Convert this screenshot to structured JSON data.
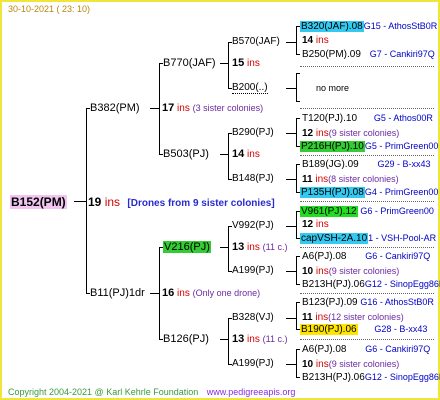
{
  "header": {
    "date": "30-10-2021 ( 23: 10)"
  },
  "root": {
    "name": "B152(PM)",
    "ins": "19",
    "ins_label": "ins",
    "note": "[Drones from 9 sister colonies]"
  },
  "gen2": [
    {
      "name": "B382(PM)",
      "ins": "17",
      "ins_label": "ins",
      "note": "(3 sister colonies)"
    },
    {
      "name": "B11(PJ)1dr",
      "ins": "16",
      "ins_label": "ins",
      "note": "(Only one drone)"
    }
  ],
  "gen3": [
    {
      "name": "B770(JAF)",
      "ins": "15",
      "ins_label": "ins"
    },
    {
      "name": "B503(PJ)",
      "ins": "14",
      "ins_label": "ins"
    },
    {
      "name": "V216(PJ)",
      "ins": "13",
      "ins_label": "ins",
      "note": "(11 c.)"
    },
    {
      "name": "B126(PJ)",
      "ins": "13",
      "ins_label": "ins",
      "note": "(11 c.)"
    }
  ],
  "gen4": [
    {
      "name": "B570(JAF)",
      "ins": "14",
      "ins_label": "ins"
    },
    {
      "name": "B200(..)"
    },
    {
      "name": "B290(PJ)",
      "ins": "14",
      "ins_label": "ins"
    },
    {
      "name": "B148(PJ)",
      "ins": "11",
      "ins_label": "ins"
    },
    {
      "name": "V992(PJ)",
      "ins": "12",
      "ins_label": "ins"
    },
    {
      "name": "A199(PJ)",
      "ins": "10",
      "ins_label": "ins"
    },
    {
      "name": "B328(VJ)",
      "ins": "11",
      "ins_label": "ins"
    },
    {
      "name": "A199(PJ)",
      "ins": "10",
      "ins_label": "ins"
    }
  ],
  "gen5": {
    "g1": {
      "top": "B320(JAF).08",
      "top_tail": "G15 - AthosStB0R",
      "mid": "14",
      "mid_label": "ins",
      "bot": "B250(PM).09",
      "bot_tail": "G7 - Cankiri97Q"
    },
    "g2": {
      "no_more": "no more"
    },
    "g3": {
      "top": "T120(PJ).10",
      "top_tail": "G5 - Athos00R",
      "mid": "12",
      "mid_label": "ins",
      "mid_note": "(9 sister colonies)",
      "bot": "P216H(PJ).10",
      "bot_tail": "G5 - PrimGreen00"
    },
    "g4": {
      "top": "B189(JG).09",
      "top_tail": "G29 - B-xx43",
      "mid": "11",
      "mid_label": "ins",
      "mid_note": "(8 sister colonies)",
      "bot": "P135H(PJ).08",
      "bot_tail": "G4 - PrimGreen00"
    },
    "g5": {
      "top": "V961(PJ).12",
      "top_tail": "G6 - PrimGreen00",
      "mid": "12",
      "mid_label": "ins",
      "bot": "capVSH-2A.10",
      "bot_tail": "1 - VSH-Pool-AR"
    },
    "g6": {
      "top": "A6(PJ).08",
      "top_tail": "G6 - Cankiri97Q",
      "mid": "10",
      "mid_label": "ins",
      "mid_note": "(9 sister colonies)",
      "bot": "B213H(PJ).06",
      "bot_tail": "G12 - SinopEgg86R"
    },
    "g7": {
      "top": "B123(PJ).09",
      "top_tail": "G16 - AthosStB0R",
      "mid": "11",
      "mid_label": "ins",
      "mid_note": "(12 sister colonies)",
      "bot": "B190(PJ).06",
      "bot_tail": "G28 - B-xx43"
    },
    "g8": {
      "top": "A6(PJ).08",
      "top_tail": "G6 - Cankiri97Q",
      "mid": "10",
      "mid_label": "ins",
      "mid_note": "(9 sister colonies)",
      "bot": "B213H(PJ).06",
      "bot_tail": "G12 - SinopEgg86R"
    }
  },
  "footer": {
    "copyright": "Copyright 2004-2021 @ Karl Kehrle Foundation",
    "site": "www.pedigreeapis.org"
  }
}
